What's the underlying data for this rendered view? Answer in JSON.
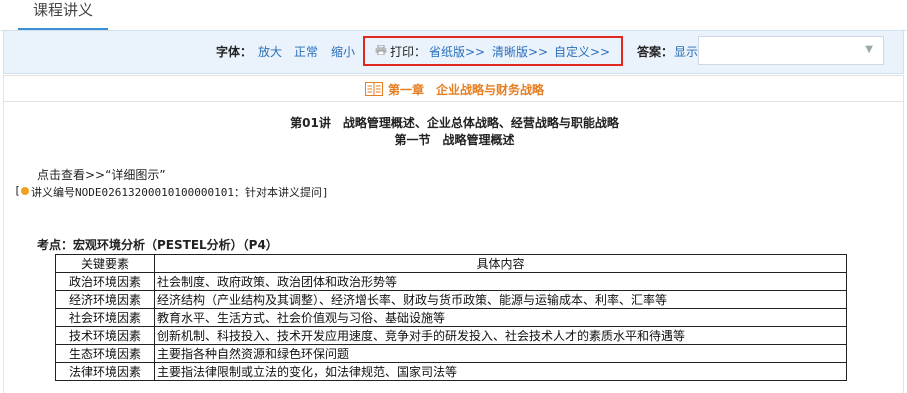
{
  "tab": {
    "label": "课程讲义"
  },
  "toolbar": {
    "font_label": "字体：",
    "font_bigger": "放大",
    "font_normal": "正常",
    "font_smaller": "缩小",
    "print_label": "打印：",
    "print_paper": "省纸版>>",
    "print_clear": "清晰版>>",
    "print_custom": "自定义>>",
    "answer_label": "答案：",
    "answer_show": "显示",
    "select_value": ""
  },
  "chapter": {
    "title": "第一章　企业战略与财务战略"
  },
  "lecture": {
    "title": "第01讲　战略管理概述、企业总体战略、经营战略与职能战略",
    "section": "第一节　战略管理概述",
    "view_link": "点击查看>>“详细图示”",
    "note_prefix": "[",
    "note_text": "讲义编号NODE02613200010100000101：针对本讲义提问]"
  },
  "kaodian": "考点：宏观环境分析（PESTEL分析）（P4）",
  "table": {
    "headers": [
      "关键要素",
      "具体内容"
    ],
    "rows": [
      [
        "政治环境因素",
        "社会制度、政府政策、政治团体和政治形势等"
      ],
      [
        "经济环境因素",
        "经济结构（产业结构及其调整）、经济增长率、财政与货币政策、能源与运输成本、利率、汇率等"
      ],
      [
        "社会环境因素",
        "教育水平、生活方式、社会价值观与习俗、基础设施等"
      ],
      [
        "技术环境因素",
        "创新机制、科技投入、技术开发应用速度、竞争对手的研发投入、社会技术人才的素质水平和待遇等"
      ],
      [
        "生态环境因素",
        "主要指各种自然资源和绿色环保问题"
      ],
      [
        "法律环境因素",
        "主要指法律限制或立法的变化，如法律规范、国家司法等"
      ]
    ]
  },
  "colors": {
    "link": "#2a6fb9",
    "highlight": "#e0281e",
    "chapter": "#e67e22"
  }
}
